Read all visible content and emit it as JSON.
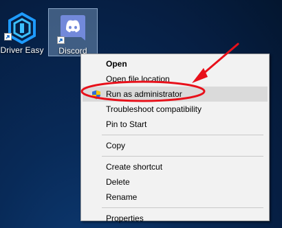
{
  "desktop": {
    "icons": [
      {
        "label": "Driver Easy",
        "icon": "driver-easy-icon"
      },
      {
        "label": "Discord",
        "icon": "discord-icon"
      }
    ]
  },
  "context_menu": {
    "items": [
      {
        "label": "Open",
        "bold": true
      },
      {
        "label": "Open file location"
      },
      {
        "label": "Run as administrator",
        "icon": "uac-shield-icon",
        "highlighted": true
      },
      {
        "label": "Troubleshoot compatibility"
      },
      {
        "label": "Pin to Start"
      },
      {
        "label": "Copy"
      },
      {
        "label": "Create shortcut"
      },
      {
        "label": "Delete"
      },
      {
        "label": "Rename"
      },
      {
        "label": "Properties"
      }
    ]
  },
  "colors": {
    "desktop_background": "#082a58",
    "menu_background": "#f2f2f2",
    "menu_highlight": "#dadada",
    "annotation_red": "#e8101a",
    "discord_blurple": "#7289da"
  }
}
